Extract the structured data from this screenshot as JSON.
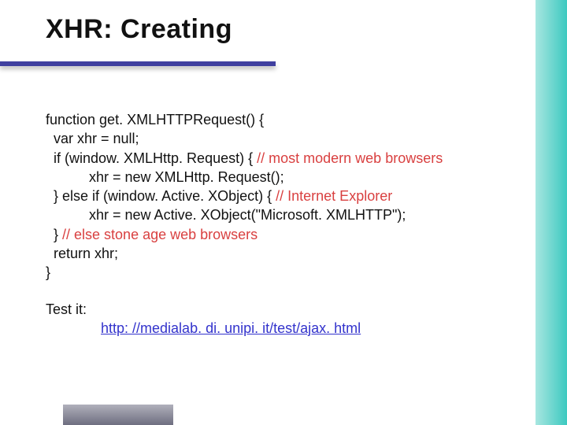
{
  "slide": {
    "title": "XHR: Creating",
    "code": {
      "l1": "function get. XMLHTTPRequest() {",
      "l2": "  var xhr = null;",
      "l3a": "  if (window. XMLHttp. Request) { ",
      "l3b": "// most modern web browsers",
      "l4": "           xhr = new XMLHttp. Request();",
      "l5a": "  } else if (window. Active. XObject) { ",
      "l5b": "// Internet Explorer",
      "l6": "           xhr = new Active. XObject(\"Microsoft. XMLHTTP\");",
      "l7a": "  } ",
      "l7b": "// else stone age web browsers",
      "l8": "  return xhr;",
      "l9": "}"
    },
    "test_label": "Test it:",
    "test_url": "http: //medialab. di. unipi. it/test/ajax. html"
  }
}
